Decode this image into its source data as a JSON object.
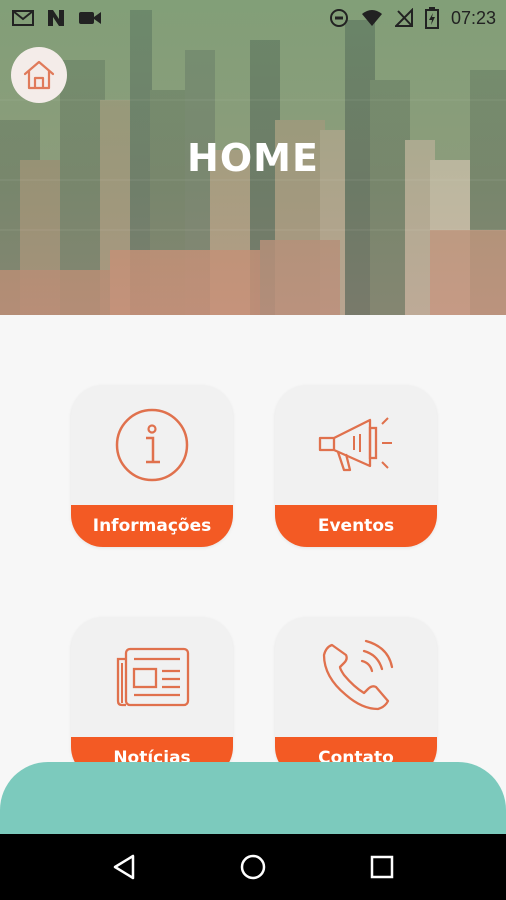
{
  "status_bar": {
    "time": "07:23",
    "left_icons": [
      "gmail-icon",
      "n-app-icon",
      "video-icon"
    ],
    "right_icons": [
      "data-saver-icon",
      "wifi-icon",
      "no-signal-icon",
      "battery-icon"
    ]
  },
  "header": {
    "title": "HOME",
    "home_button_icon": "home-icon"
  },
  "tiles": [
    {
      "label": "Informações",
      "icon": "info-icon"
    },
    {
      "label": "Eventos",
      "icon": "megaphone-icon"
    },
    {
      "label": "Notícias",
      "icon": "newspaper-icon"
    },
    {
      "label": "Contato",
      "icon": "phone-icon"
    }
  ],
  "colors": {
    "accent": "#f35a24",
    "icon_stroke": "#e0714d",
    "bottom_sheet": "#7ccabd",
    "tile_bg": "#f1f1f1"
  },
  "nav_bar": {
    "buttons": [
      "back-icon",
      "home-circle-icon",
      "recents-icon"
    ]
  }
}
